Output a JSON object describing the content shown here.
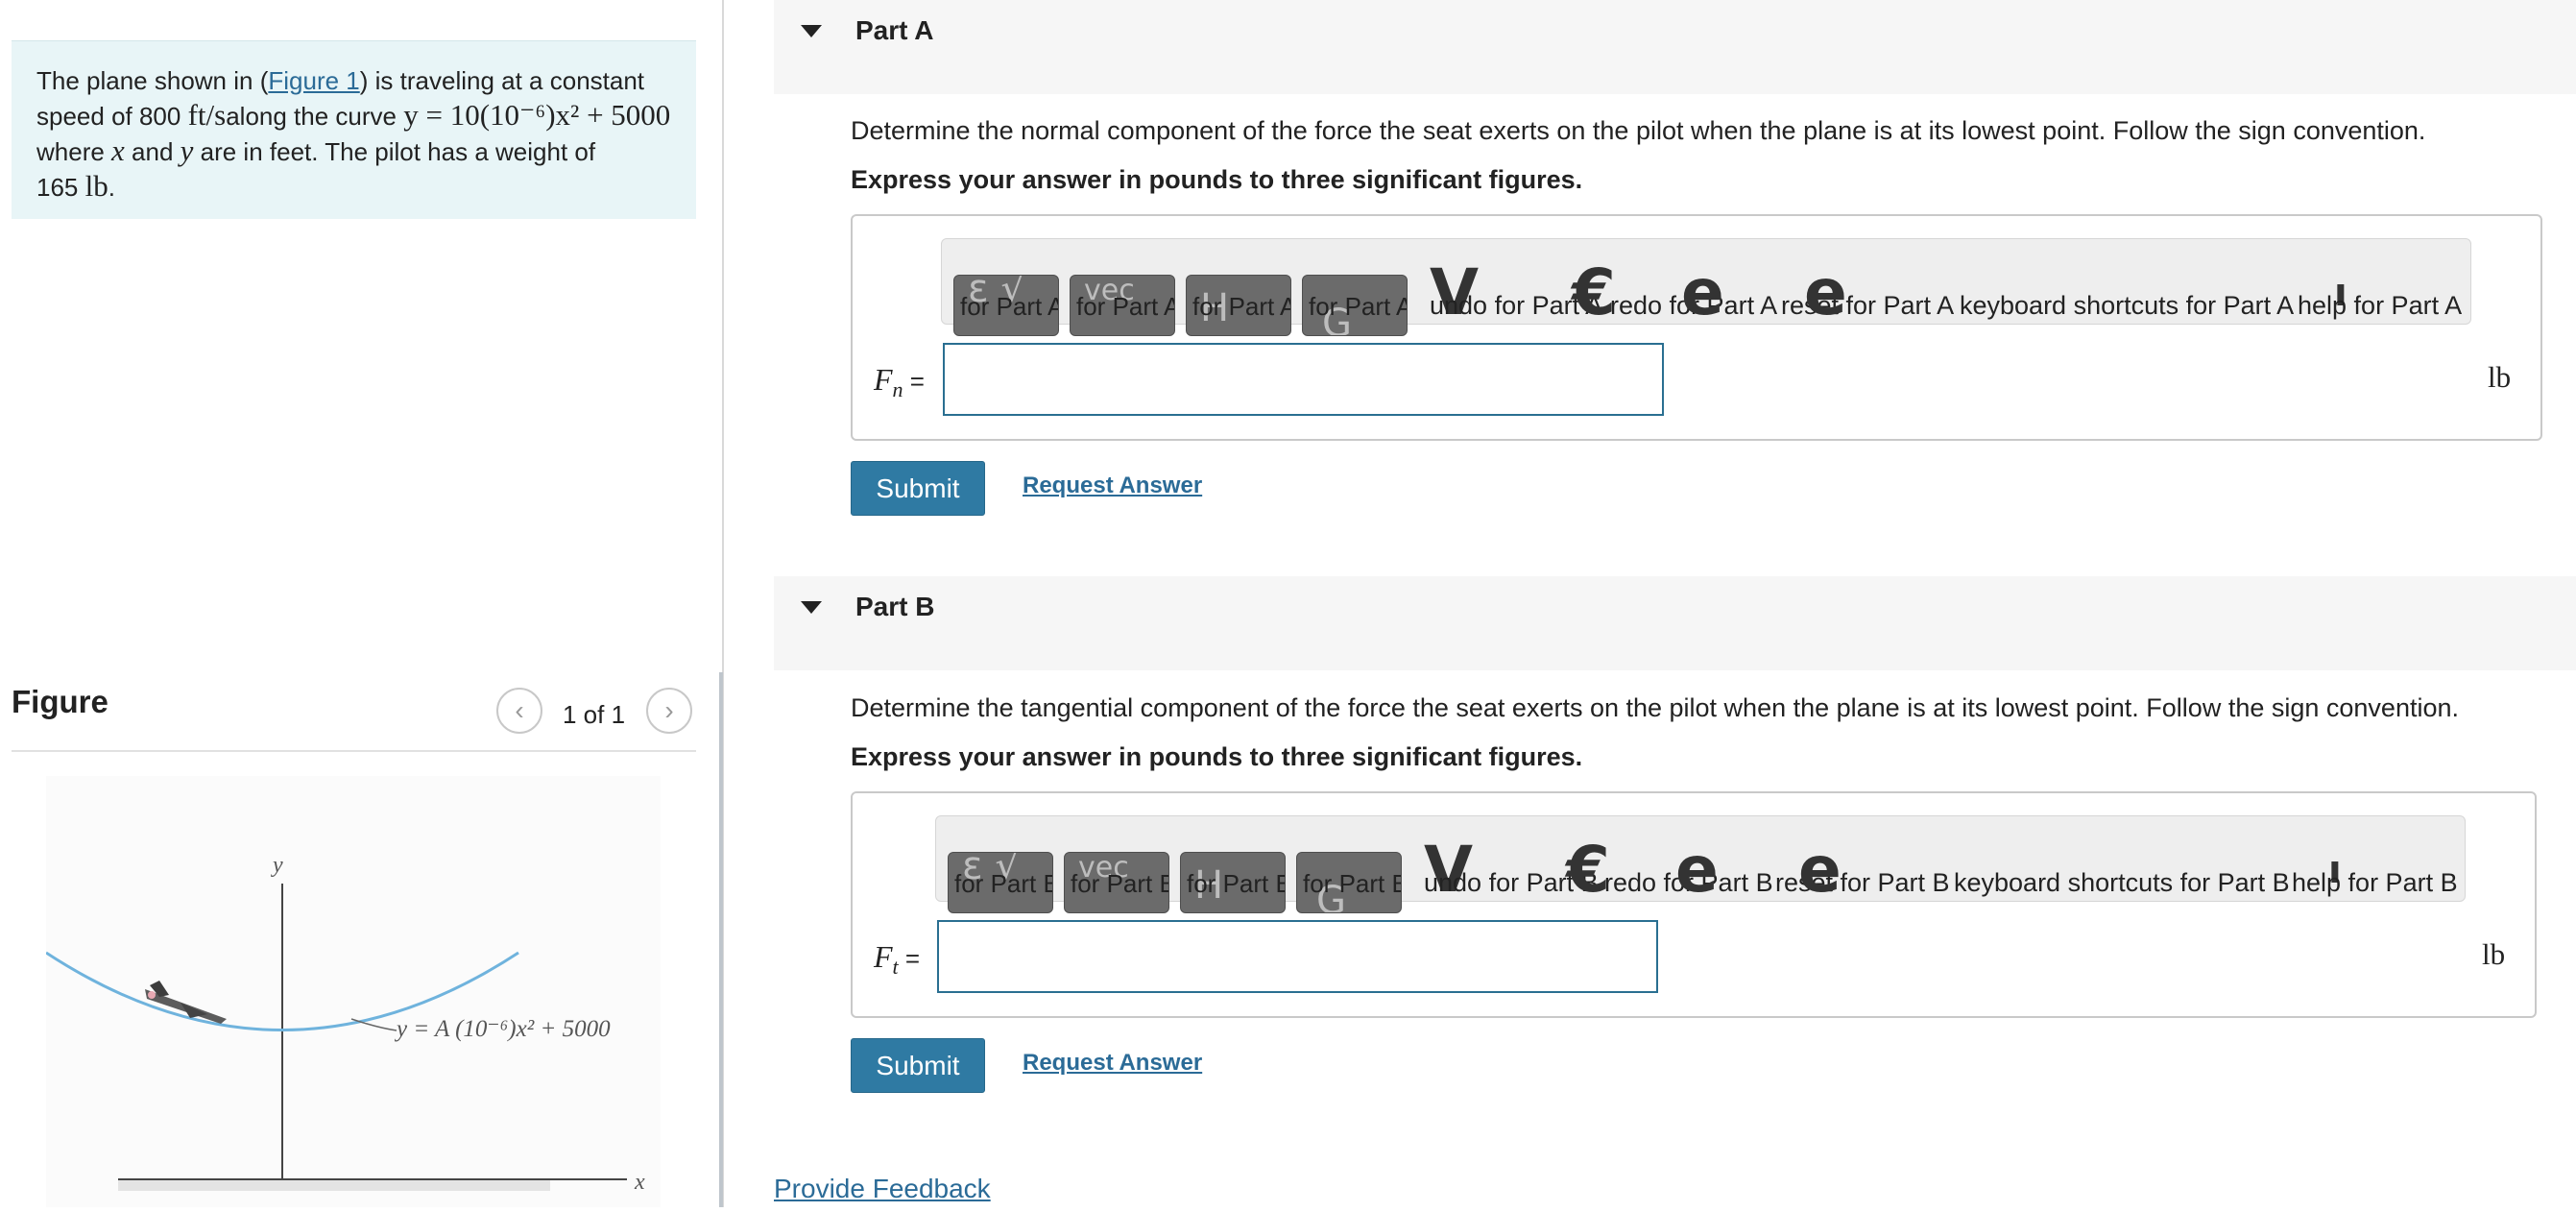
{
  "problem": {
    "text_1": "The plane shown in (",
    "figure_link": "Figure 1",
    "text_2": ") is traveling at a constant",
    "text_3": "speed of 800 ",
    "unit_speed": "ft/s",
    "text_4": "along the curve ",
    "equation": "y = 10(10⁻⁶)x² + 5000",
    "text_5": "where ",
    "var_x": "x",
    "text_6": " and ",
    "var_y": "y",
    "text_7": " are in feet. The pilot has a weight of",
    "text_8": "165 ",
    "unit_weight": "lb",
    "text_9": "."
  },
  "figure": {
    "title": "Figure",
    "page_indicator": "1 of 1",
    "prev_icon": "chevron-left-icon",
    "next_icon": "chevron-right-icon",
    "axis_x": "x",
    "axis_y": "y",
    "curve_label": "y = A (10⁻⁶)x² + 5000"
  },
  "parts": [
    {
      "title": "Part A",
      "question": "Determine the normal component of the force the seat exerts on the pilot when the plane is at its lowest point. Follow the sign convention.",
      "instruction": "Express your answer in pounds to three significant figures.",
      "toolbar": {
        "btn1": "for Part A",
        "btn2": "for Part A",
        "btn3": "for Part A",
        "btn4": "for Part A",
        "undo": "undo for Part A",
        "redo": "redo for Part A",
        "reset": "reset for Part A",
        "shortcuts": "keyboard shortcuts for Part A",
        "help": "help for Part A"
      },
      "variable": "F",
      "subscript": "n",
      "equals": " =",
      "input_value": "",
      "unit": "lb",
      "submit": "Submit",
      "request": "Request Answer"
    },
    {
      "title": "Part B",
      "question": "Determine the tangential component of the force the seat exerts on the pilot when the plane is at its lowest point. Follow the sign convention.",
      "instruction": "Express your answer in pounds to three significant figures.",
      "toolbar": {
        "btn1": "for Part B",
        "btn2": "for Part B",
        "btn3": "for Part B",
        "btn4": "for Part B",
        "undo": "undo for Part B",
        "redo": "redo for Part B",
        "reset": "reset for Part B",
        "shortcuts": "keyboard shortcuts for Part B",
        "help": "help for Part B"
      },
      "variable": "F",
      "subscript": "t",
      "equals": " =",
      "input_value": "",
      "unit": "lb",
      "submit": "Submit",
      "request": "Request Answer"
    }
  ],
  "toolbar_glyphs": {
    "templates": "ε √",
    "vector": "vec",
    "undo_icon": "undo-icon",
    "redo_icon": "redo-icon",
    "reset_icon": "reset-icon",
    "keyboard_icon": "keyboard-icon",
    "help_icon": "help-icon"
  },
  "feedback": "Provide Feedback",
  "colors": {
    "accent": "#2f7aa3",
    "link": "#2b6b97",
    "problem_bg": "#e8f5f7",
    "curve": "#6fb3dd"
  }
}
